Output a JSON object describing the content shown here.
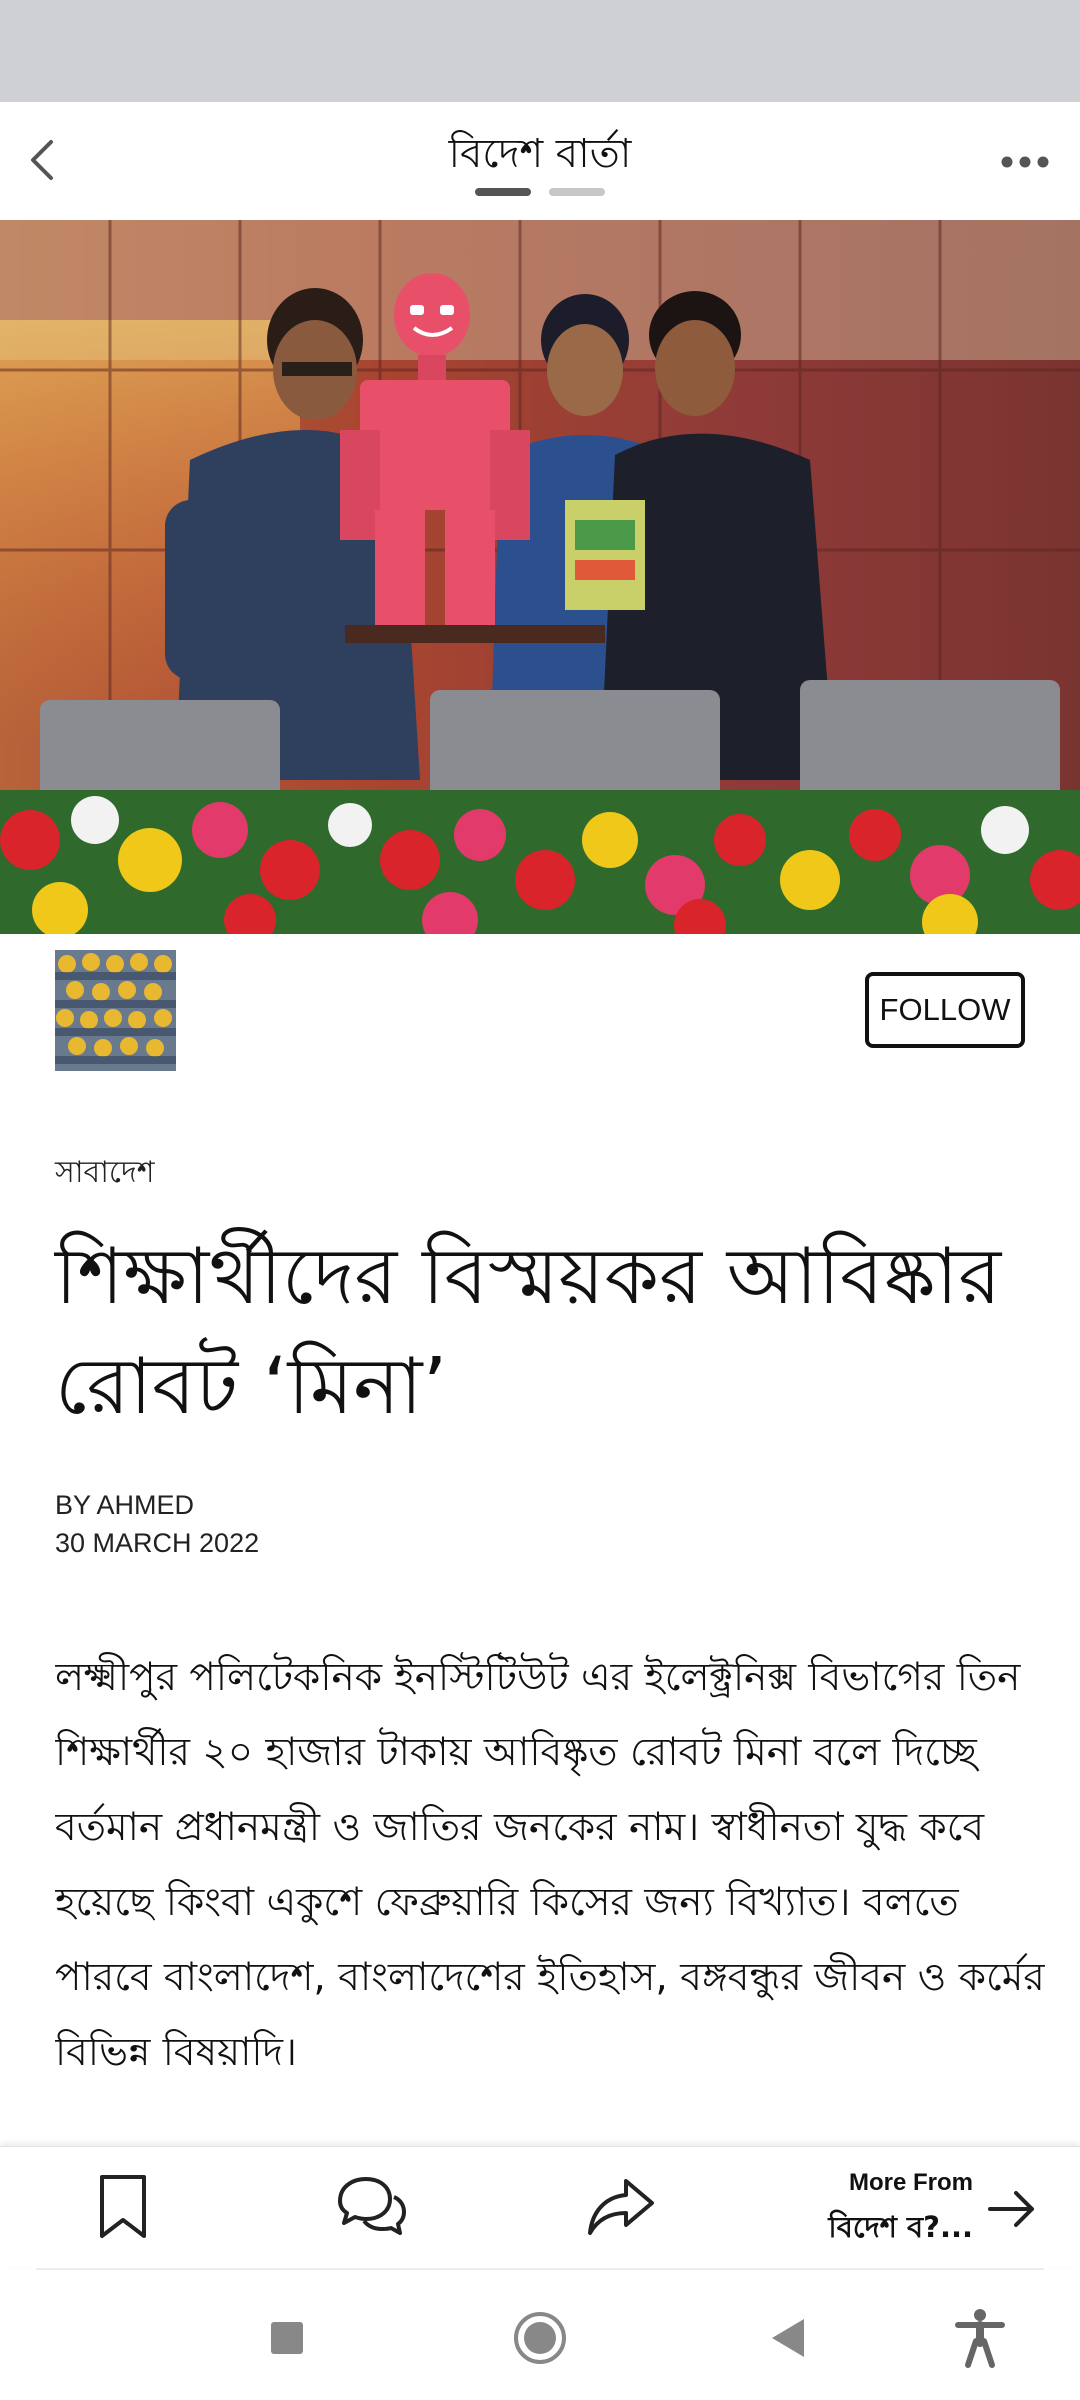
{
  "header": {
    "title": "বিদেশ বার্তা",
    "page_count": 2,
    "active_page": 1
  },
  "source": {
    "follow_label": "FOLLOW"
  },
  "article": {
    "section": "সাবাদেশ",
    "headline": "শিক্ষার্থীদের বিস্ময়কর আবিষ্কার রোবট ‘মিনা’",
    "byline": "BY AHMED",
    "date": "30 MARCH 2022",
    "body": "লক্ষ্মীপুর পলিটেকনিক ইনস্টিটিউট এর ইলেক্ট্রনিক্স বিভাগের তিন শিক্ষার্থীর ২০ হাজার টাকায় আবিষ্কৃত রোবট মিনা বলে দিচ্ছে বর্তমান প্রধানমন্ত্রী ও জাতির জনকের নাম। স্বাধীনতা যুদ্ধ কবে হয়েছে কিংবা একুশে ফেব্রুয়ারি কিসের জন্য বিখ্যাত। বলতে পারবে বাংলাদেশ, বাংলাদেশের ইতিহাস, বঙ্গবন্ধুর জীবন ও কর্মের বিভিন্ন বিষয়াদি।"
  },
  "bottom_bar": {
    "more_from_label": "More From",
    "more_from_name": "বিদেশ ব?..."
  },
  "icons": {
    "back": "chevron-left-icon",
    "more": "more-horizontal-icon",
    "bookmark": "bookmark-icon",
    "comments": "comments-icon",
    "share": "share-icon",
    "arrow": "arrow-right-icon",
    "recents": "square-icon",
    "home": "circle-icon",
    "nav_back": "triangle-back-icon",
    "accessibility": "accessibility-icon"
  },
  "colors": {
    "status_bar": "#cfd0d4",
    "text": "#111111",
    "robot": "#e8506a"
  }
}
